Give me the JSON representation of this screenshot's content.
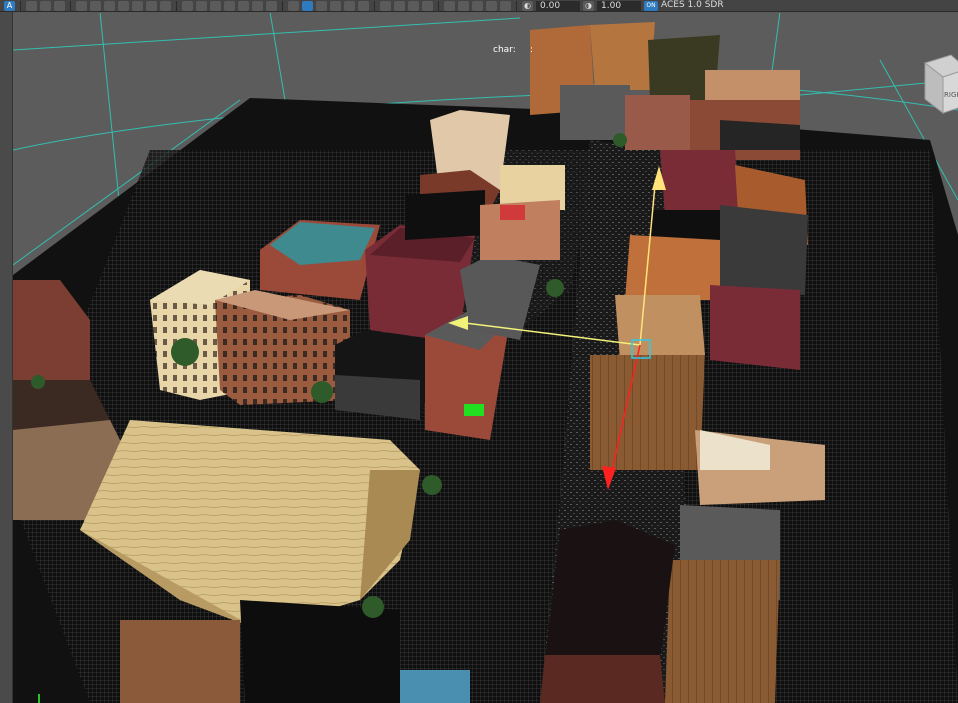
{
  "toolbar": {
    "icons": [
      "select-tool-icon",
      "lasso-icon",
      "paint-icon",
      "camera-icon",
      "film-icon",
      "image-icon",
      "bookmark-icon",
      "book-icon",
      "pen-icon",
      "camera-attr-icon",
      "pencil-icon",
      "grid-icon",
      "film-gate-icon",
      "resolution-gate-icon",
      "gate-mask-icon",
      "field-chart-icon",
      "safe-action-icon",
      "safe-title-icon",
      "wireframe-icon",
      "smooth-shade-icon",
      "default-material-icon",
      "textured-icon",
      "lighting-icon",
      "shadows-icon",
      "ambient-occlusion-icon",
      "motion-blur-icon",
      "anti-alias-icon",
      "depth-of-field-icon",
      "isolate-icon",
      "xray-icon",
      "xray-joints-icon",
      "xray-active-icon",
      "backface-icon"
    ],
    "exposure_value": "0.00",
    "gamma_value": "1.00",
    "color_mgmt_badge": "ON",
    "color_space": "ACES 1.0 SDR"
  },
  "viewport": {
    "hud_label": "char:",
    "hud_value": ":",
    "viewcube_face": "RIGHT"
  },
  "colors": {
    "viewport_bg": "#5c5c5c",
    "grid": "#2fc9b8",
    "manip_x": "#f2f27a",
    "manip_y": "#ffe27a",
    "manip_z": "#ff2020",
    "accent": "#2f7bbf"
  }
}
